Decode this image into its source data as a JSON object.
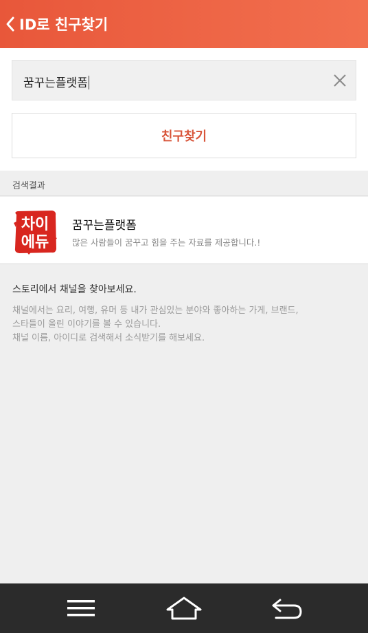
{
  "header": {
    "title": "ID로 친구찾기",
    "back_icon": "chevron-left-icon"
  },
  "search": {
    "value": "꿈꾸는플랫폼",
    "clear_icon": "close-icon"
  },
  "find_button": {
    "label": "친구찾기"
  },
  "results": {
    "section_label": "검색결과",
    "items": [
      {
        "name": "꿈꾸는플랫폼",
        "description": "많은 사람들이 꿈꾸고 힘을 주는 자료를 제공합니다.!",
        "avatar_text": "차이에듀"
      }
    ]
  },
  "info": {
    "title": "스토리에서 채널을 찾아보세요.",
    "lines": [
      "채널에서는 요리, 여행, 유머 등 내가 관심있는 분야와 좋아하는 가게, 브랜드,",
      "스타들이 올린 이야기를 볼 수 있습니다.",
      "채널 이름, 아이디로 검색해서 소식받기를 해보세요."
    ]
  },
  "nav": {
    "menu_icon": "menu-icon",
    "home_icon": "home-icon",
    "back_icon": "back-arrow-icon"
  },
  "colors": {
    "accent": "#e8573a",
    "button_text": "#d8553a",
    "nav_background": "#2b2b2b"
  }
}
